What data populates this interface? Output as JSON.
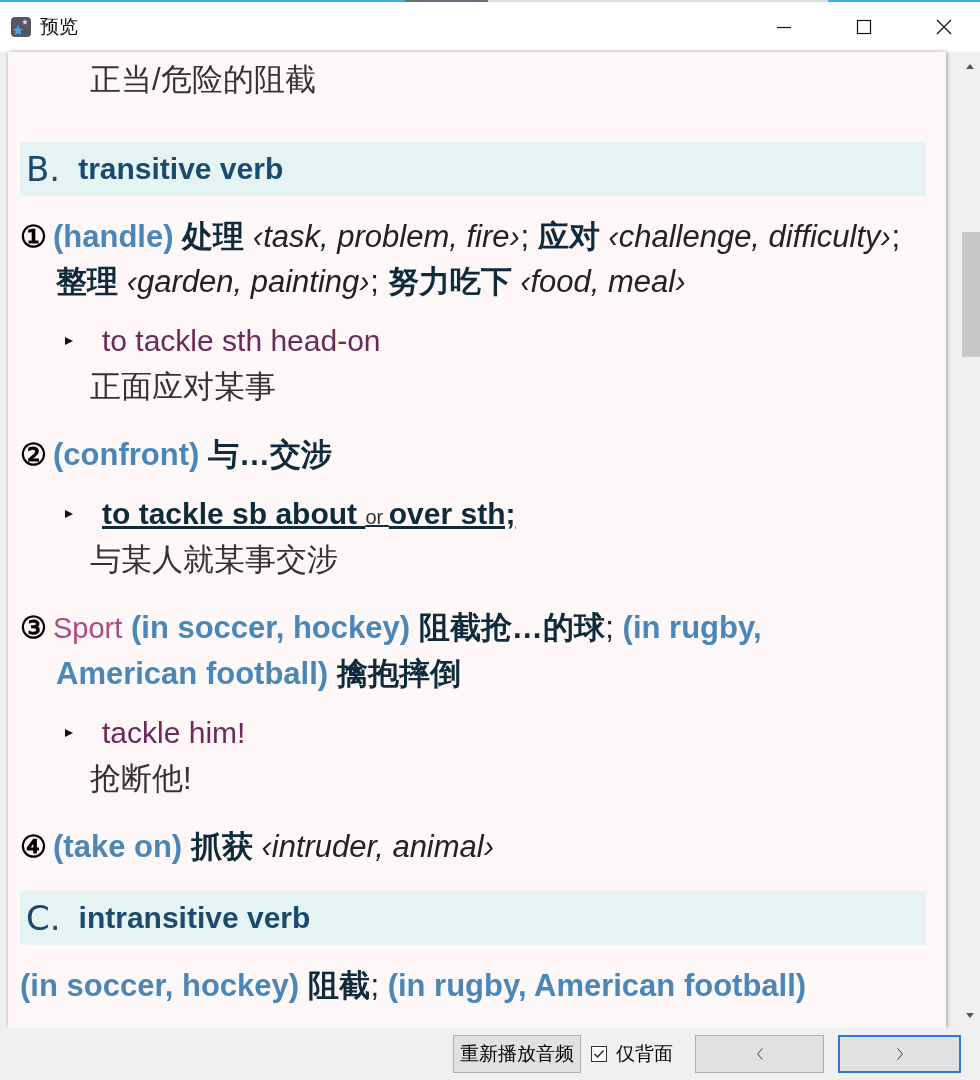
{
  "window": {
    "title": "预览"
  },
  "entry": [
    {
      "kind": "translation",
      "text": "正当/危险的阻截"
    },
    {
      "kind": "pos-header",
      "letter": "B.",
      "title": "transitive verb"
    },
    {
      "kind": "sense",
      "number": "①",
      "parts": [
        {
          "kind": "gloss",
          "text": "(handle)"
        },
        {
          "kind": "zh",
          "text": "处理"
        },
        {
          "kind": "colloc",
          "text": "‹task, problem, fire›"
        },
        {
          "kind": "punct",
          "text": ";"
        },
        {
          "kind": "zh",
          "text": "应对"
        },
        {
          "kind": "colloc",
          "text": "‹challenge,"
        },
        {
          "kind": "colloc",
          "text": "difficulty›"
        },
        {
          "kind": "punct",
          "text": ";"
        },
        {
          "kind": "zh",
          "text": "整理"
        },
        {
          "kind": "colloc",
          "text": "‹garden, painting›"
        },
        {
          "kind": "punct",
          "text": ";"
        },
        {
          "kind": "zh",
          "text": "努力吃下"
        },
        {
          "kind": "colloc",
          "text": "‹food, meal›"
        }
      ],
      "examples": [
        {
          "parts": [
            {
              "kind": "example",
              "text": "to tackle sth head-on"
            }
          ],
          "zh": "正面应对某事"
        }
      ]
    },
    {
      "kind": "sense",
      "number": "②",
      "parts": [
        {
          "kind": "gloss",
          "text": "(confront)"
        },
        {
          "kind": "zh",
          "text": "与…交涉"
        }
      ],
      "examples": [
        {
          "parts": [
            {
              "kind": "phrase",
              "text": "to tackle sb about"
            },
            {
              "kind": "or",
              "text": "or"
            },
            {
              "kind": "phrase",
              "text": "over sth;"
            }
          ],
          "zh": "与某人就某事交涉"
        }
      ]
    },
    {
      "kind": "sense",
      "number": "③",
      "parts": [
        {
          "kind": "label",
          "text": "Sport"
        },
        {
          "kind": "gloss",
          "text": "(in soccer, hockey)"
        },
        {
          "kind": "zh",
          "text": "阻截抢…的球"
        },
        {
          "kind": "punct",
          "text": " ;"
        },
        {
          "kind": "gloss",
          "text": "(in rugby,"
        },
        {
          "kind": "gloss",
          "text": "American football)"
        },
        {
          "kind": "zh",
          "text": "擒抱摔倒"
        }
      ],
      "examples": [
        {
          "parts": [
            {
              "kind": "example",
              "text": "tackle him!"
            }
          ],
          "zh": "抢断他!"
        }
      ]
    },
    {
      "kind": "sense",
      "number": "④",
      "parts": [
        {
          "kind": "gloss",
          "text": "(take on)"
        },
        {
          "kind": "zh",
          "text": "抓获"
        },
        {
          "kind": "colloc",
          "text": "‹intruder, animal›"
        }
      ]
    },
    {
      "kind": "pos-header",
      "letter": "C.",
      "title": "intransitive verb"
    },
    {
      "kind": "plain-sense",
      "parts": [
        {
          "kind": "gloss",
          "text": "(in soccer, hockey)"
        },
        {
          "kind": "zh",
          "text": "阻截"
        },
        {
          "kind": "punct",
          "text": " ;"
        },
        {
          "kind": "gloss",
          "text": "(in rugby, American football)"
        }
      ]
    }
  ],
  "footer": {
    "replay_button": "重新播放音频",
    "back_only": {
      "label": "仅背面",
      "checked": true
    }
  }
}
